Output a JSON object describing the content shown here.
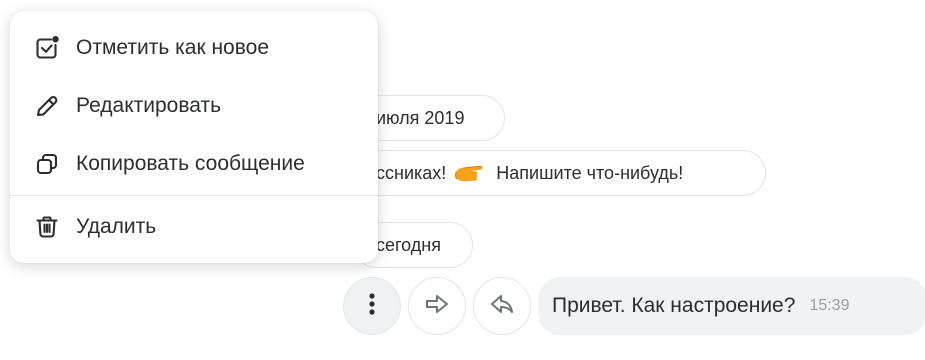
{
  "chat": {
    "date_pill": "июля 2019",
    "info_pill": {
      "text_before": "ссниках!",
      "emoji_icon": "pointing-hand-icon",
      "text_after": "Напишите что-нибудь!"
    },
    "today_pill": "сегодня"
  },
  "message": {
    "text": "Привет. Как настроение?",
    "time": "15:39"
  },
  "message_actions": [
    {
      "name": "more-icon",
      "active": true
    },
    {
      "name": "forward-icon",
      "active": false
    },
    {
      "name": "reply-icon",
      "active": false
    }
  ],
  "context_menu": {
    "items": [
      {
        "label": "Отметить как новое",
        "icon": "mark-unread-icon"
      },
      {
        "label": "Редактировать",
        "icon": "pencil-icon"
      },
      {
        "label": "Копировать сообщение",
        "icon": "copy-icon"
      },
      {
        "label": "Удалить",
        "icon": "trash-icon"
      }
    ]
  },
  "colors": {
    "bubble_bg": "#f1f2f4",
    "pill_border": "#e3e4e6",
    "text": "#2c2d2e",
    "muted": "#9a9ea4"
  }
}
